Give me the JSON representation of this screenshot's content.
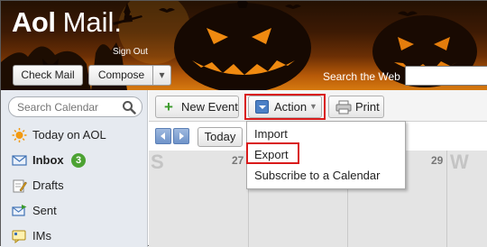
{
  "header": {
    "logo_brand": "Aol",
    "logo_product": "Mail.",
    "signout_label": "Sign Out",
    "check_mail_label": "Check Mail",
    "compose_label": "Compose",
    "compose_arrow": "▾",
    "search_web_label": "Search the Web",
    "search_web_value": ""
  },
  "sidebar": {
    "search_placeholder": "Search Calendar",
    "items": [
      {
        "label": "Today on AOL",
        "icon": "sun-icon"
      },
      {
        "label": "Inbox",
        "icon": "envelope-icon",
        "badge": "3"
      },
      {
        "label": "Drafts",
        "icon": "pencil-paper-icon"
      },
      {
        "label": "Sent",
        "icon": "sent-icon"
      },
      {
        "label": "IMs",
        "icon": "im-icon"
      }
    ]
  },
  "toolbar": {
    "new_event_label": "New Event",
    "new_event_plus": "+",
    "action_label": "Action",
    "action_arrow": "▼",
    "print_label": "Print"
  },
  "calendar": {
    "today_label": "Today",
    "day_letters": [
      "S",
      "W"
    ],
    "day_numbers": [
      "27",
      "29"
    ]
  },
  "action_menu": {
    "items": [
      "Import",
      "Export",
      "Subscribe to a Calendar"
    ]
  },
  "colors": {
    "highlight_red": "#d91a1a",
    "badge_green": "#4ca233",
    "banner_orange": "#d67a10"
  }
}
